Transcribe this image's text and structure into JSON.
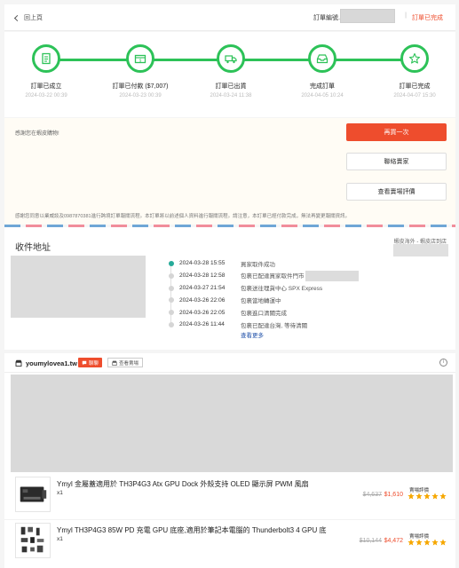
{
  "header": {
    "back_label": "回上頁",
    "order_no_label": "訂單編號.",
    "separator": "|",
    "status": "訂單已完成"
  },
  "tracker": {
    "steps": [
      {
        "label": "訂單已成立",
        "time": "2024-03-22 00:39",
        "icon": "receipt-icon"
      },
      {
        "label": "訂單已付款 ($7,007)",
        "time": "2024-03-23 00:39",
        "icon": "payment-icon"
      },
      {
        "label": "訂單已出貨",
        "time": "2024-03-24 11:38",
        "icon": "truck-icon"
      },
      {
        "label": "完成訂單",
        "time": "2024-04-05 10:24",
        "icon": "inbox-icon"
      },
      {
        "label": "訂單已完成",
        "time": "2024-04-07 15:30",
        "icon": "star-icon"
      }
    ],
    "accent": "#2dc258"
  },
  "actions": {
    "thanks": "感謝您在蝦皮購物!",
    "buy_again": "再買一次",
    "contact_seller": "聯絡賣家",
    "view_review": "查看賣場評價",
    "notice": "感謝您同意以業威談及0987870381進行跨境訂單報關流程。本訂單將以前述個人資料進行報關流程。請注意，本訂單已經付款完成，無法再變更報關資訊。"
  },
  "address": {
    "title": "收件地址",
    "carrier": "蝦皮海外 - 蝦皮店到店",
    "timeline": [
      {
        "time": "2024-03-28 15:55",
        "desc": "買家取件成功"
      },
      {
        "time": "2024-03-28 12:58",
        "desc": "包裹已配達買家取件門市"
      },
      {
        "time": "2024-03-27 21:54",
        "desc": "包裹送往理貨中心 SPX Express"
      },
      {
        "time": "2024-03-26 22:06",
        "desc": "包裹當地轉運中"
      },
      {
        "time": "2024-03-26 22:05",
        "desc": "包裹進口清關完成"
      },
      {
        "time": "2024-03-26 11:44",
        "desc": "包裹已配達台灣, 等待清關"
      }
    ],
    "more": "查看更多"
  },
  "shop": {
    "name": "youmylovea1.tw",
    "chat": "聊聊",
    "view_shop": "查看賣場",
    "items": [
      {
        "name": "Ymyl 金屬蓋適用於 TH3P4G3 Atx GPU Dock 外殼支持 OLED 顯示屏 PWM 風扇",
        "qty": "x1",
        "old_price": "$4,637",
        "price": "$1,610",
        "rating_label": "賣場評價",
        "stars": 5
      },
      {
        "name": "Ymyl TH3P4G3 85W PD 充電 GPU 底座,適用於筆記本電腦的 Thunderbolt3 4 GPU 底",
        "qty": "x1",
        "old_price": "$10,144",
        "price": "$4,472",
        "rating_label": "賣場評價",
        "stars": 5
      }
    ],
    "star_color": "#f6a700"
  }
}
